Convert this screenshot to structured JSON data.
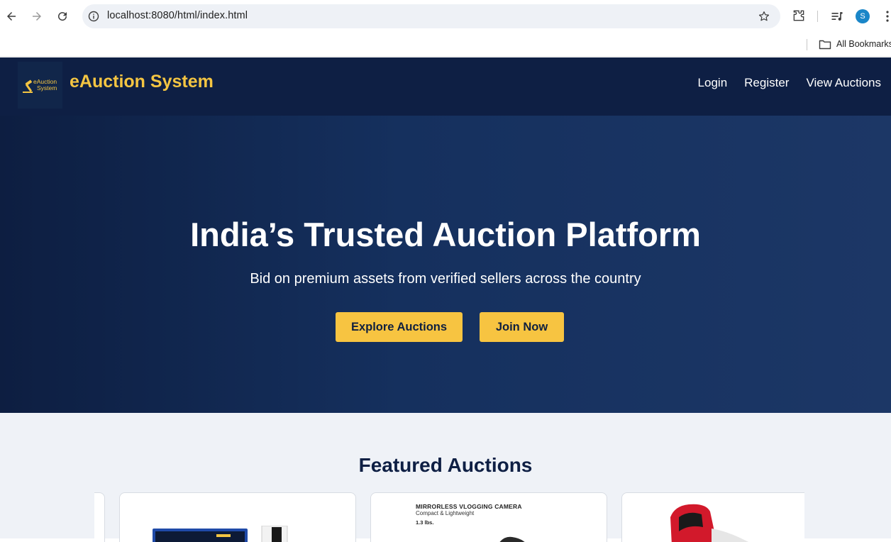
{
  "browser": {
    "url": "localhost:8080/html/index.html",
    "profile_initial": "S",
    "bookmarks_label": "All Bookmarks"
  },
  "header": {
    "logo_text_line1": "eAuction",
    "logo_text_line2": "System",
    "brand": "eAuction System",
    "nav": [
      "Login",
      "Register",
      "View Auctions"
    ]
  },
  "hero": {
    "title": "India’s Trusted Auction Platform",
    "subtitle": "Bid on premium assets from verified sellers across the country",
    "explore_label": "Explore Auctions",
    "join_label": "Join Now"
  },
  "featured": {
    "title": "Featured Auctions",
    "camera_card": {
      "line1": "MIRRORLESS VLOGGING CAMERA",
      "line2": "Compact & Lightweight",
      "line3": "1.3 lbs."
    }
  },
  "colors": {
    "header_bg": "#0e1f44",
    "accent": "#f7c441",
    "brand_text": "#f4c542",
    "section_bg": "#eff2f7"
  }
}
